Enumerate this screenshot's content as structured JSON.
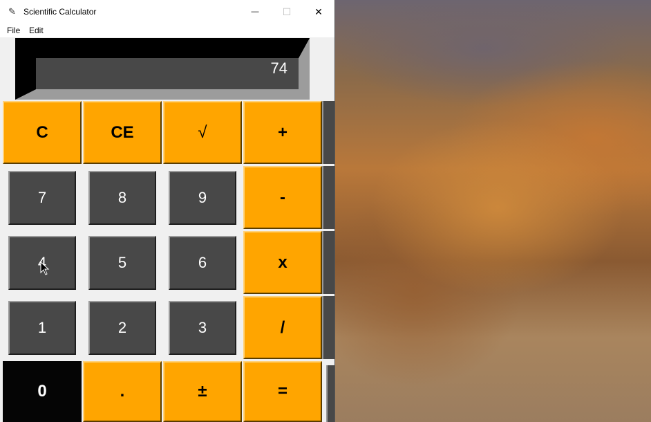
{
  "window": {
    "title": "Scientific Calculator",
    "icon": "feather-icon",
    "controls": {
      "minimize": "—",
      "maximize": "☐",
      "close": "✕"
    }
  },
  "menu": {
    "items": [
      "File",
      "Edit"
    ]
  },
  "display": {
    "value": "74"
  },
  "buttons": {
    "clear": "C",
    "clear_entry": "CE",
    "sqrt": "√",
    "plus": "+",
    "minus": "-",
    "multiply": "x",
    "divide": "/",
    "equals": "=",
    "decimal": ".",
    "plus_minus": "±",
    "d7": "7",
    "d8": "8",
    "d9": "9",
    "d4": "4",
    "d5": "5",
    "d6": "6",
    "d1": "1",
    "d2": "2",
    "d3": "3",
    "d0": "0"
  },
  "colors": {
    "operator": "#ffa500",
    "digit": "#484848",
    "display_bg": "#484848",
    "zero_key": "#050505"
  }
}
